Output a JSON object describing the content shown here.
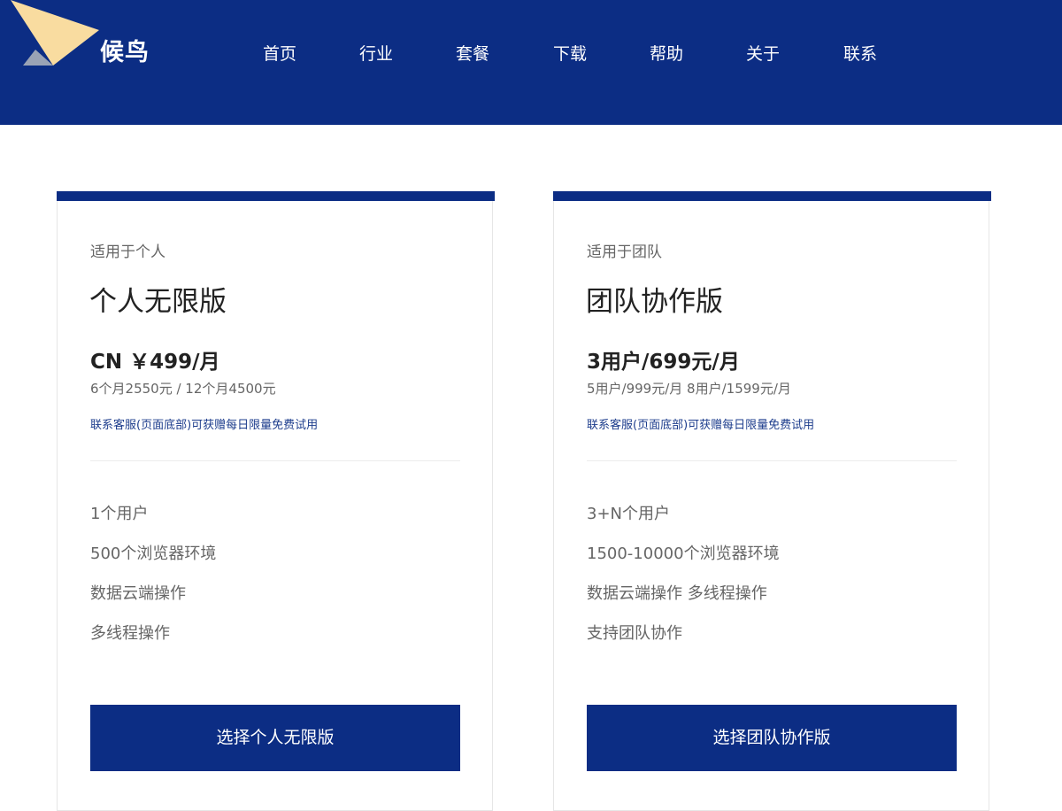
{
  "brand": {
    "name": "候鸟",
    "accent": "#0c2d84",
    "logo_colors": [
      "#f9dca0",
      "#9aa3b5"
    ]
  },
  "nav": {
    "items": [
      {
        "label": "首页",
        "key": "home"
      },
      {
        "label": "行业",
        "key": "industry"
      },
      {
        "label": "套餐",
        "key": "plans"
      },
      {
        "label": "下载",
        "key": "download"
      },
      {
        "label": "帮助",
        "key": "help"
      },
      {
        "label": "关于",
        "key": "about"
      },
      {
        "label": "联系",
        "key": "contact"
      }
    ]
  },
  "plans": [
    {
      "audience": "适用于个人",
      "name": "个人无限版",
      "price": "CN ￥499/月",
      "price_options": "6个月2550元 / 12个月4500元",
      "trial_note": "联系客服(页面底部)可获赠每日限量免费试用",
      "features": [
        "1个用户",
        "500个浏览器环境",
        "数据云端操作",
        "多线程操作"
      ],
      "button_label": "选择个人无限版"
    },
    {
      "audience": "适用于团队",
      "name": "团队协作版",
      "price": "3用户/699元/月",
      "price_options": "5用户/999元/月 8用户/1599元/月",
      "trial_note": "联系客服(页面底部)可获赠每日限量免费试用",
      "features": [
        "3+N个用户",
        "1500-10000个浏览器环境",
        "数据云端操作 多线程操作",
        "支持团队协作"
      ],
      "button_label": "选择团队协作版"
    }
  ]
}
